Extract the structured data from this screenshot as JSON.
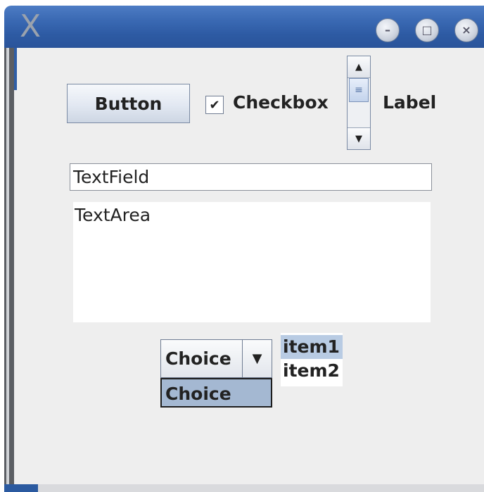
{
  "window": {
    "logo_text": "X",
    "controls": [
      {
        "icon": "minimize-icon",
        "glyph": "–"
      },
      {
        "icon": "maximize-icon",
        "glyph": "□"
      },
      {
        "icon": "close-icon",
        "glyph": "×"
      }
    ]
  },
  "button": {
    "label": "Button"
  },
  "checkbox": {
    "label": "Checkbox",
    "checked": true,
    "mark": "✔"
  },
  "scrollbar": {
    "up": "▲",
    "down": "▼",
    "thumb": "≡"
  },
  "label": {
    "text": "Label"
  },
  "textfield": {
    "value": "TextField"
  },
  "textarea": {
    "value": "TextArea"
  },
  "choice": {
    "selected": "Choice",
    "arrow": "▼",
    "popup_option": "Choice"
  },
  "list": {
    "items": [
      "item1",
      "item2"
    ],
    "selected_index": 0
  },
  "colors": {
    "titlebar": "#3a69b3",
    "selection": "#b8cbe3",
    "popup": "#a4b8d2"
  }
}
